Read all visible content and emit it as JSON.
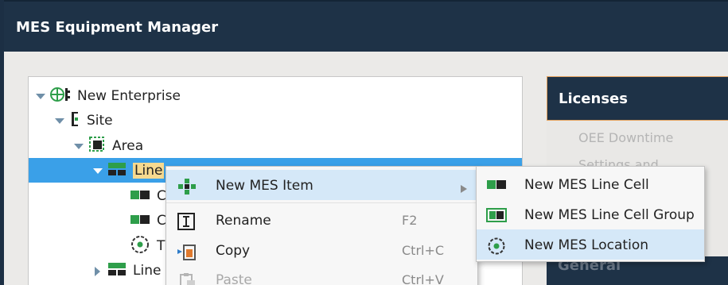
{
  "window": {
    "title": "MES Equipment Manager"
  },
  "tree": {
    "items": [
      {
        "label": "New Enterprise",
        "icon": "enterprise-icon"
      },
      {
        "label": "Site",
        "icon": "site-icon"
      },
      {
        "label": "Area",
        "icon": "area-icon"
      },
      {
        "label": "Line",
        "icon": "line-icon",
        "selected": true
      },
      {
        "label": "C",
        "icon": "line-cell-icon"
      },
      {
        "label": "C",
        "icon": "line-cell-icon"
      },
      {
        "label": "T",
        "icon": "location-icon"
      },
      {
        "label": "Line",
        "icon": "line-icon"
      }
    ]
  },
  "context_menu": {
    "items": [
      {
        "label": "New MES Item",
        "icon": "new-item-icon",
        "shortcut": "",
        "has_submenu": true,
        "highlighted": true
      },
      {
        "label": "Rename",
        "icon": "rename-icon",
        "shortcut": "F2"
      },
      {
        "label": "Copy",
        "icon": "copy-icon",
        "shortcut": "Ctrl+C"
      },
      {
        "label": "Paste",
        "icon": "paste-icon",
        "shortcut": "Ctrl+V",
        "disabled": true
      }
    ]
  },
  "submenu": {
    "items": [
      {
        "label": "New MES Line Cell",
        "icon": "line-cell-icon"
      },
      {
        "label": "New MES Line Cell Group",
        "icon": "line-cell-group-icon"
      },
      {
        "label": "New MES Location",
        "icon": "location-icon",
        "highlighted": true
      }
    ]
  },
  "side_panel": {
    "licenses_header": "Licenses",
    "license_items": [
      "OEE Downtime",
      "Settings and Changeover"
    ],
    "general_header": "General"
  },
  "colors": {
    "title_bar": "#1e3247",
    "selection": "#3aa0e8",
    "menu_highlight": "#d5e8f8",
    "accent_border": "#e3a05b",
    "mes_green": "#2e9e4a"
  }
}
